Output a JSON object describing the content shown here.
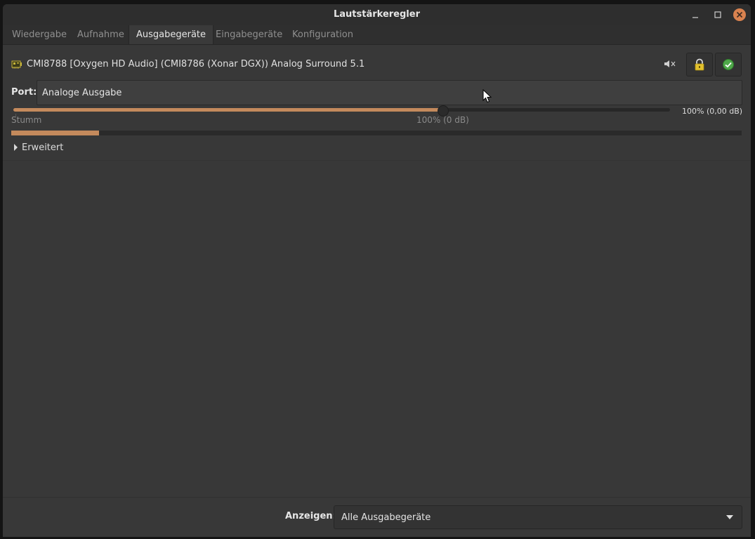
{
  "window": {
    "title": "Lautstärkeregler",
    "close_color": "#d9824f",
    "accent": "#c48a5c"
  },
  "tabs": [
    {
      "label": "Wiedergabe",
      "active": false
    },
    {
      "label": "Aufnahme",
      "active": false
    },
    {
      "label": "Ausgabegeräte",
      "active": true
    },
    {
      "label": "Eingabegeräte",
      "active": false
    },
    {
      "label": "Konfiguration",
      "active": false
    }
  ],
  "device": {
    "icon": "sound-card-icon",
    "name": "CMI8788 [Oxygen HD Audio] (CMI8786 (Xonar DGX)) Analog Surround 5.1",
    "mute_icon": "speaker-mute-icon",
    "lock_icon": "lock-icon",
    "default_icon": "checkmark-icon"
  },
  "port": {
    "label": "Port:",
    "value": "Analoge Ausgabe"
  },
  "volume": {
    "level_fraction": 0.654,
    "readout": "100% (0,00 dB)",
    "mark_mute": "Stumm",
    "mark_100": "100% (0 dB)",
    "peak_fraction": 0.12
  },
  "advanced": {
    "label": "Erweitert"
  },
  "footer": {
    "show_label": "Anzeigen:",
    "show_value": "Alle Ausgabegeräte"
  }
}
